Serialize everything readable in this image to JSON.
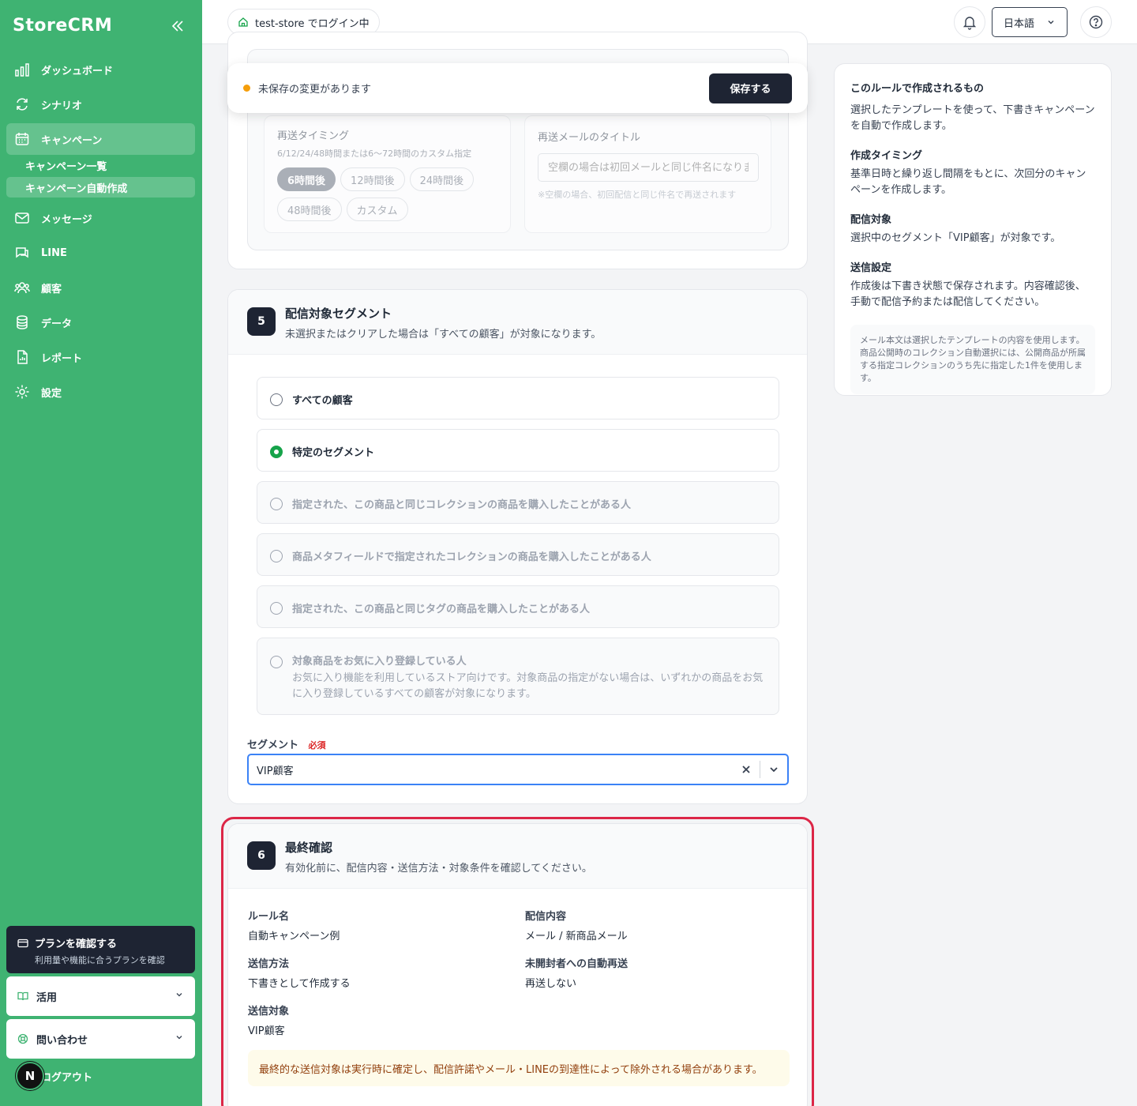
{
  "sidebar": {
    "logo": "StoreCRM",
    "nav": [
      {
        "label": "ダッシュボード",
        "icon": "dashboard-icon"
      },
      {
        "label": "シナリオ",
        "icon": "scenario-icon"
      },
      {
        "label": "キャンペーン",
        "icon": "calendar-icon"
      },
      {
        "label": "メッセージ",
        "icon": "mail-icon"
      },
      {
        "label": "LINE",
        "icon": "chat-icon"
      },
      {
        "label": "顧客",
        "icon": "users-icon"
      },
      {
        "label": "データ",
        "icon": "database-icon"
      },
      {
        "label": "レポート",
        "icon": "report-icon"
      },
      {
        "label": "設定",
        "icon": "gear-icon"
      }
    ],
    "sub": [
      "キャンペーン一覧",
      "キャンペーン自動作成"
    ],
    "plan": {
      "title": "プランを確認する",
      "sub": "利用量や機能に合うプランを確認"
    },
    "katsuyou": "活用",
    "contact": "問い合わせ",
    "logout": "ログアウト",
    "avatar": "N"
  },
  "topbar": {
    "store": "test-store でログイン中",
    "lang": "日本語"
  },
  "unsaved": {
    "text": "未保存の変更があります",
    "save": "保存する"
  },
  "resend": {
    "timing_label": "再送タイミング",
    "timing_hint": "6/12/24/48時間または6〜72時間のカスタム指定",
    "chips": [
      "6時間後",
      "12時間後",
      "24時間後",
      "48時間後",
      "カスタム"
    ],
    "title_label": "再送メールのタイトル",
    "title_placeholder": "空欄の場合は初回メールと同じ件名になります",
    "title_hint": "※空欄の場合、初回配信と同じ件名で再送されます"
  },
  "segment": {
    "step": "5",
    "title": "配信対象セグメント",
    "desc": "未選択またはクリアした場合は「すべての顧客」が対象になります。",
    "options": [
      {
        "label": "すべての顧客"
      },
      {
        "label": "特定のセグメント"
      },
      {
        "label": "指定された、この商品と同じコレクションの商品を購入したことがある人"
      },
      {
        "label": "商品メタフィールドで指定されたコレクションの商品を購入したことがある人"
      },
      {
        "label": "指定された、この商品と同じタグの商品を購入したことがある人"
      },
      {
        "label": "対象商品をお気に入り登録している人",
        "desc": "お気に入り機能を利用しているストア向けです。対象商品の指定がない場合は、いずれかの商品をお気に入り登録しているすべての顧客が対象になります。"
      }
    ],
    "field_label": "セグメント",
    "required": "必須",
    "value": "VIP顧客"
  },
  "confirm": {
    "step": "6",
    "title": "最終確認",
    "desc": "有効化前に、配信内容・送信方法・対象条件を確認してください。",
    "rule_label": "ルール名",
    "rule_value": "自動キャンペーン例",
    "content_label": "配信内容",
    "content_value": "メール / 新商品メール",
    "method_label": "送信方法",
    "method_value": "下書きとして作成する",
    "resend_label": "未開封者への自動再送",
    "resend_value": "再送しない",
    "target_label": "送信対象",
    "target_value": "VIP顧客",
    "warning": "最終的な送信対象は実行時に確定し、配信許諾やメール・LINEの到達性によって除外される場合があります。"
  },
  "info": {
    "title": "このルールで作成されるもの",
    "p1": "選択したテンプレートを使って、下書きキャンペーンを自動で作成します。",
    "h2": "作成タイミング",
    "p2": "基準日時と繰り返し間隔をもとに、次回分のキャンペーンを作成します。",
    "h3": "配信対象",
    "p3": "選択中のセグメント「VIP顧客」が対象です。",
    "h4": "送信設定",
    "p4": "作成後は下書き状態で保存されます。内容確認後、手動で配信予約または配信してください。",
    "note": "メール本文は選択したテンプレートの内容を使用します。商品公開時のコレクション自動選択には、公開商品が所属する指定コレクションのうち先に指定した1件を使用します。"
  },
  "colors": {
    "brand": "#3fb372",
    "dark": "#1e2433",
    "highlight": "#dc2647",
    "warning_bg": "#fefbea"
  }
}
